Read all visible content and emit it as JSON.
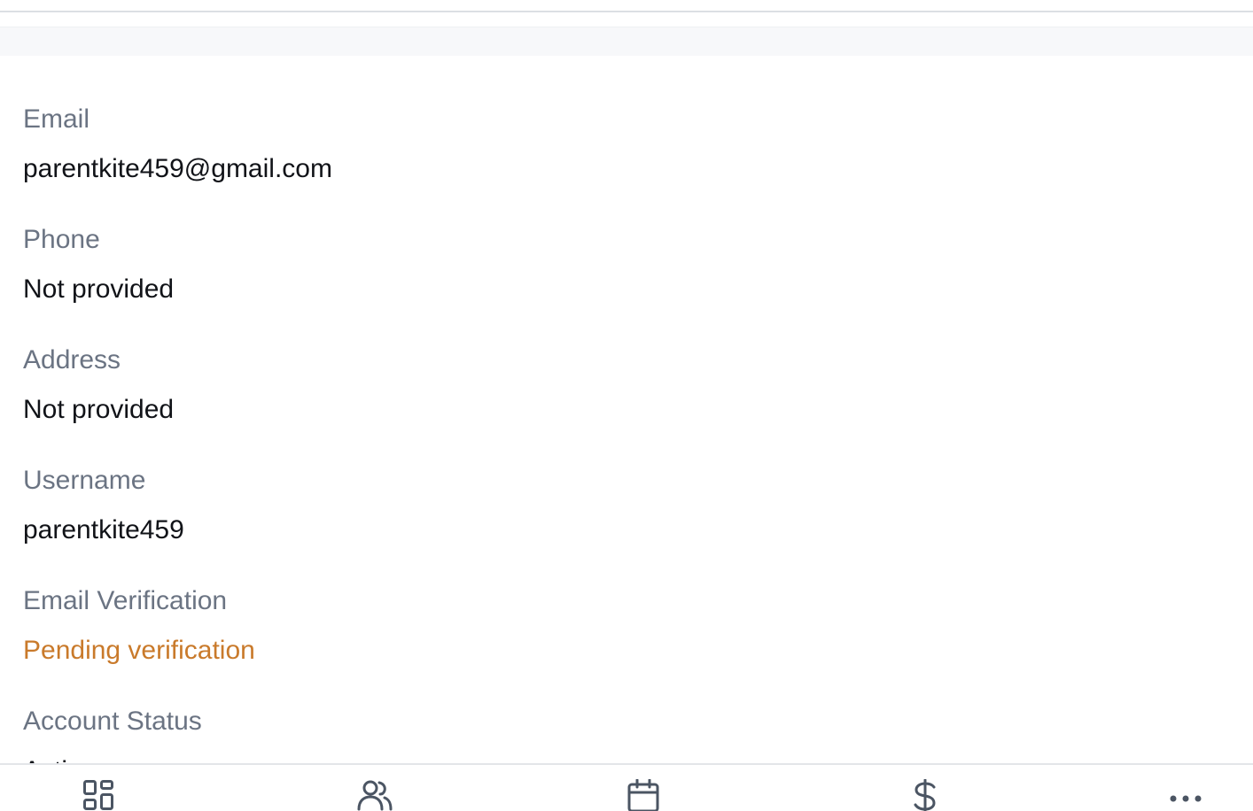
{
  "fields": [
    {
      "label": "Email",
      "value": "parentkite459@gmail.com"
    },
    {
      "label": "Phone",
      "value": "Not provided"
    },
    {
      "label": "Address",
      "value": "Not provided"
    },
    {
      "label": "Username",
      "value": "parentkite459"
    },
    {
      "label": "Email Verification",
      "value": "Pending verification"
    },
    {
      "label": "Account Status",
      "value": "Active"
    }
  ],
  "colors": {
    "label": "#6b7483",
    "value": "#111318",
    "pending": "#c97a2b",
    "tab_icon": "#4b5563"
  },
  "tabbar": {
    "items": [
      {
        "icon": "dashboard-icon"
      },
      {
        "icon": "users-icon"
      },
      {
        "icon": "calendar-icon"
      },
      {
        "icon": "dollar-icon"
      },
      {
        "icon": "more-icon"
      }
    ]
  }
}
